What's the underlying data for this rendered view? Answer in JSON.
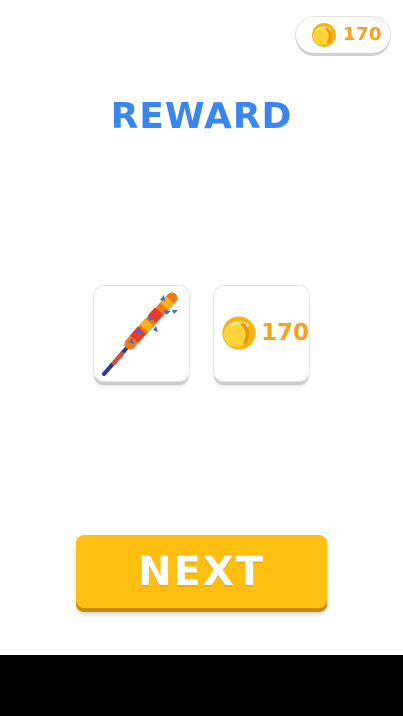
{
  "header": {
    "coin_balance": "170",
    "coin_icon": "gold-coin-icon"
  },
  "title": "REWARD",
  "rewards": [
    {
      "kind": "weapon",
      "icon": "spiked-bat-icon"
    },
    {
      "kind": "coins",
      "icon": "gold-coin-icon",
      "amount": "170"
    }
  ],
  "next_button": {
    "label": "NEXT"
  },
  "colors": {
    "title": "#3a86ee",
    "coin_text": "#f7a21a",
    "button": "#ffbf10",
    "button_shadow": "#c98b00"
  }
}
